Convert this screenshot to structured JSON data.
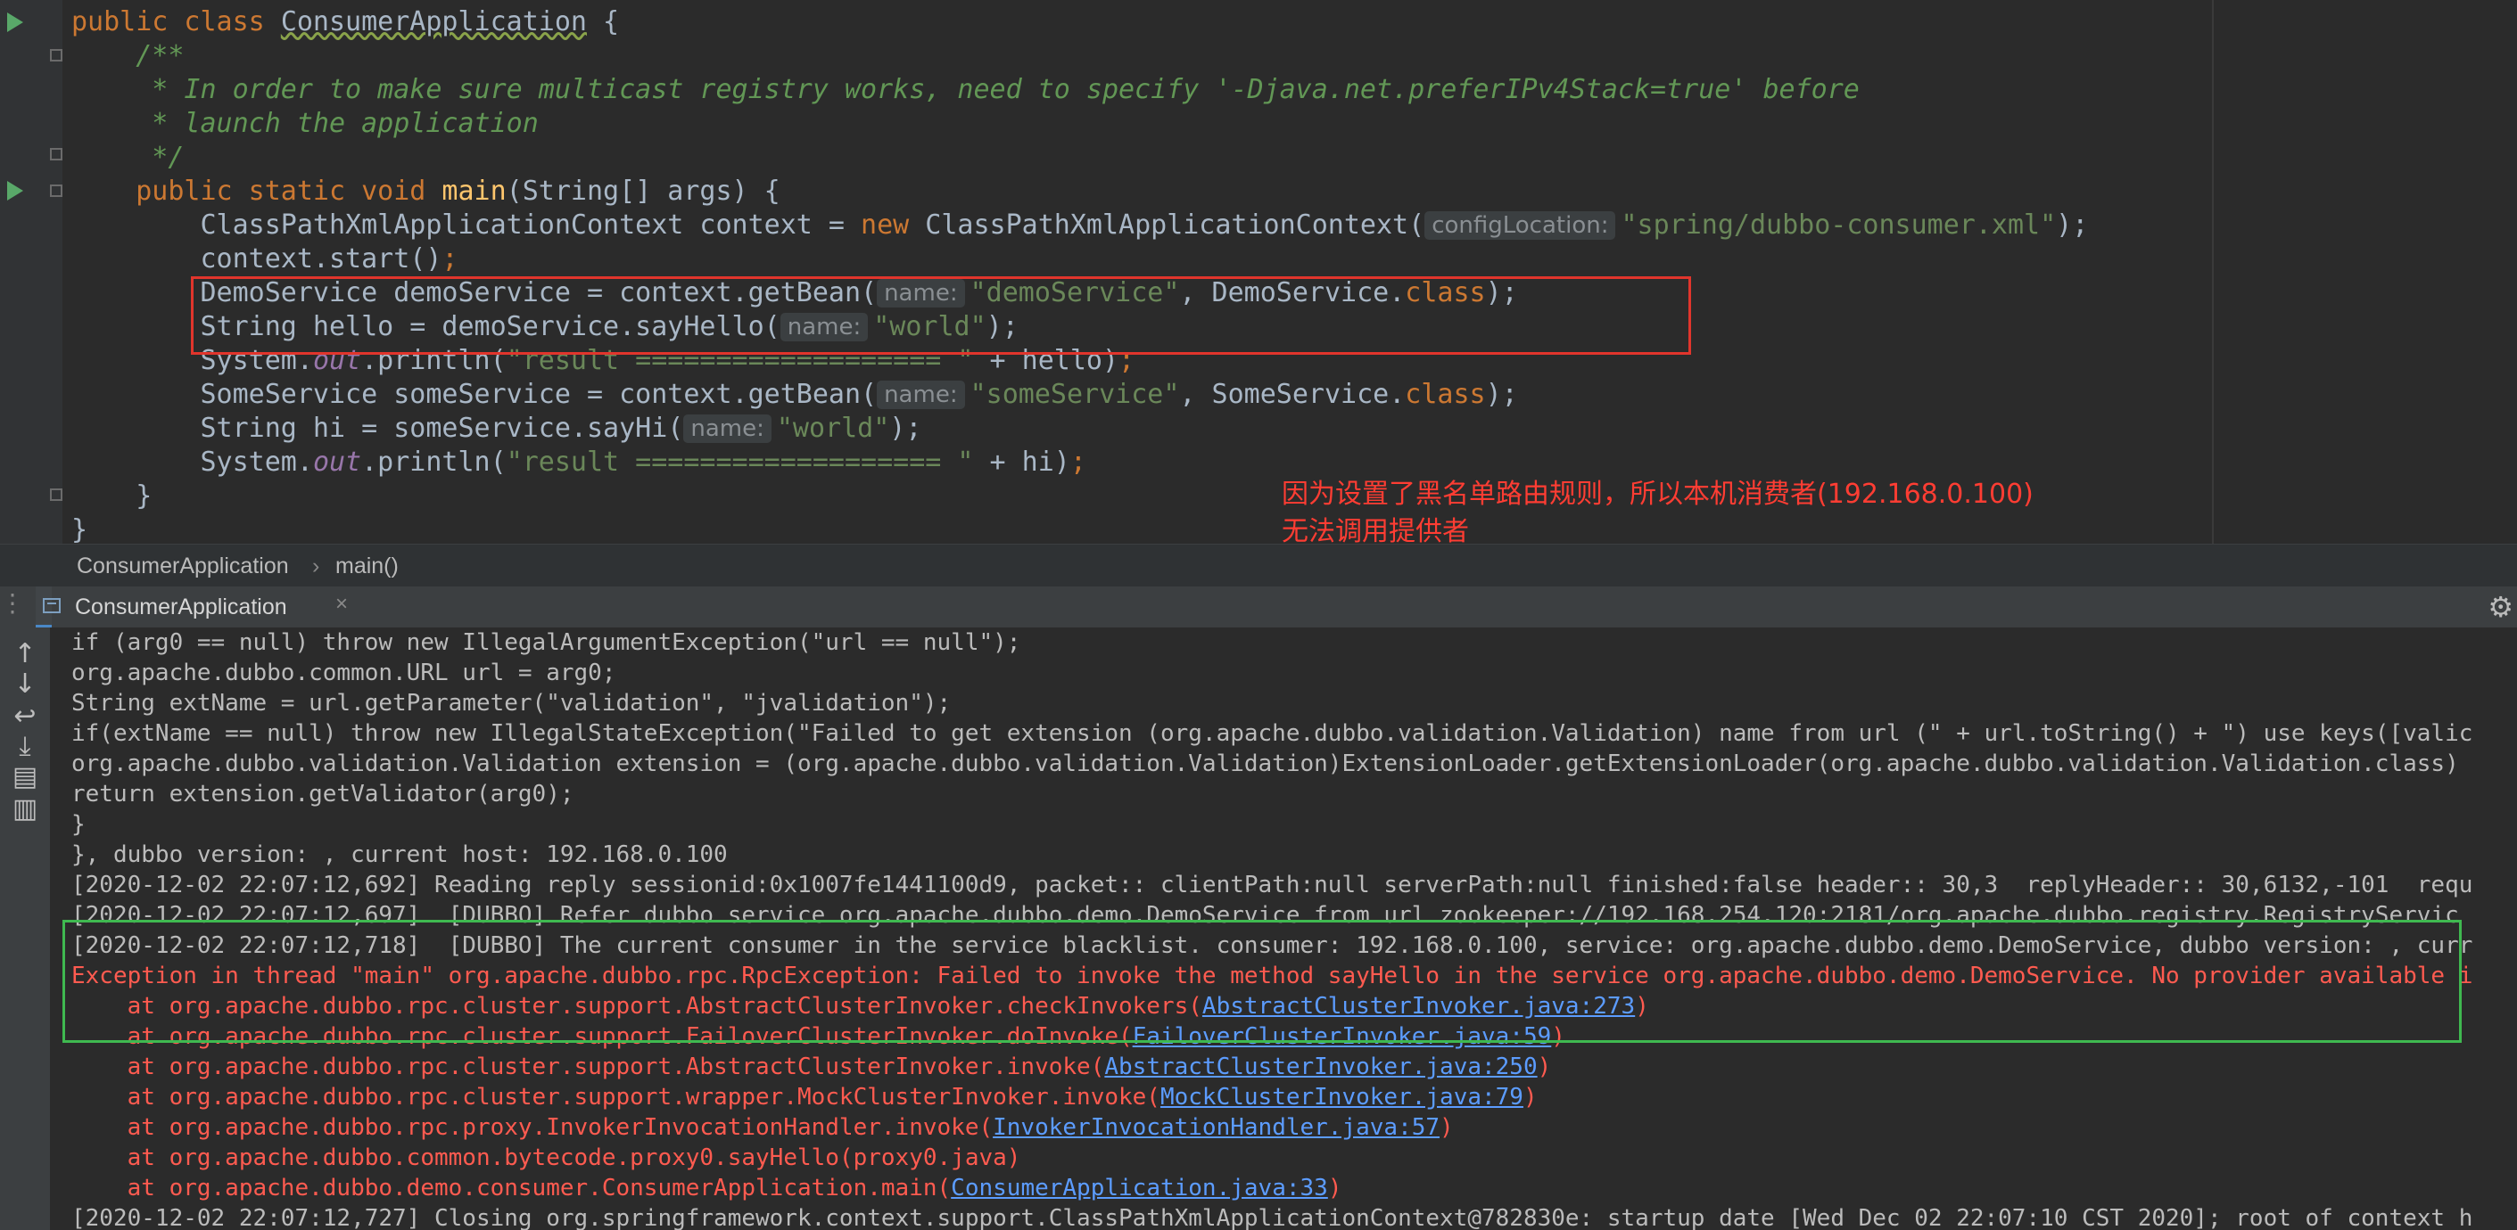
{
  "editor": {
    "lines": {
      "l1_kw": "public class ",
      "l1_class": "ConsumerApplication",
      "l1_rest": " {",
      "l2": "    /**",
      "l3": "     * In order to make sure multicast registry works, need to specify '-Djava.net.preferIPv4Stack=true' before",
      "l4": "     * launch the application",
      "l5": "     */",
      "l6_kw": "    public static void ",
      "l6_fn": "main",
      "l6_rest": "(String[] args) {",
      "l7_a": "        ClassPathXmlApplicationContext context = ",
      "l7_new": "new ",
      "l7_b": "ClassPathXmlApplicationContext(",
      "l7_hint": "configLocation:",
      "l7_str": "\"spring/dubbo-consumer.xml\"",
      "l7_end": ");",
      "l8_a": "        context.start()",
      "l8_end": ";",
      "l9_a": "        DemoService demoService = context.getBean(",
      "l9_hint": "name:",
      "l9_str": "\"demoService\"",
      "l9_b": ", DemoService.",
      "l9_kw": "class",
      "l9_end": ");",
      "l10_a": "        String hello = demoService.sayHello(",
      "l10_hint": "name:",
      "l10_str": "\"world\"",
      "l10_end": ");",
      "l11_a": "        System.",
      "l11_fld": "out",
      "l11_b": ".println(",
      "l11_str": "\"result =================== \"",
      "l11_c": " + hello)",
      "l11_end": ";",
      "l12_a": "        SomeService someService = context.getBean(",
      "l12_hint": "name:",
      "l12_str": "\"someService\"",
      "l12_b": ", SomeService.",
      "l12_kw": "class",
      "l12_end": ");",
      "l13_a": "        String hi = someService.sayHi(",
      "l13_hint": "name:",
      "l13_str": "\"world\"",
      "l13_end": ");",
      "l14_a": "        System.",
      "l14_fld": "out",
      "l14_b": ".println(",
      "l14_str": "\"result =================== \"",
      "l14_c": " + hi)",
      "l14_end": ";",
      "l15": "    }",
      "l16": "}"
    },
    "annotation": "因为设置了黑名单路由规则，所以本机消费者(192.168.0.100)\n无法调用提供者"
  },
  "breadcrumb": {
    "class": "ConsumerApplication",
    "separator": "›",
    "method": "main()"
  },
  "run_panel": {
    "tab_label": "ConsumerApplication",
    "close_glyph": "×",
    "gear_glyph": "⚙",
    "toolbar_icons": [
      "arrow-up-icon",
      "arrow-down-icon",
      "soft-wrap-icon",
      "scroll-to-end-icon",
      "print-icon",
      "trash-icon"
    ]
  },
  "console": {
    "lines": [
      "if (arg0 == null) throw new IllegalArgumentException(\"url == null\");",
      "org.apache.dubbo.common.URL url = arg0;",
      "String extName = url.getParameter(\"validation\", \"jvalidation\");",
      "if(extName == null) throw new IllegalStateException(\"Failed to get extension (org.apache.dubbo.validation.Validation) name from url (\" + url.toString() + \") use keys([valic",
      "org.apache.dubbo.validation.Validation extension = (org.apache.dubbo.validation.Validation)ExtensionLoader.getExtensionLoader(org.apache.dubbo.validation.Validation.class)",
      "return extension.getValidator(arg0);",
      "}",
      "}, dubbo version: , current host: 192.168.0.100",
      "[2020-12-02 22:07:12,692] Reading reply sessionid:0x1007fe1441100d9, packet:: clientPath:null serverPath:null finished:false header:: 30,3  replyHeader:: 30,6132,-101  requ",
      "[2020-12-02 22:07:12,697]  [DUBBO] Refer dubbo service org.apache.dubbo.demo.DemoService from url zookeeper://192.168.254.120:2181/org.apache.dubbo.registry.RegistryServic",
      "[2020-12-02 22:07:12,718]  [DUBBO] The current consumer in the service blacklist. consumer: 192.168.0.100, service: org.apache.dubbo.demo.DemoService, dubbo version: , curr"
    ],
    "exception": "Exception in thread \"main\" org.apache.dubbo.rpc.RpcException: Failed to invoke the method sayHello in the service org.apache.dubbo.demo.DemoService. No provider available i",
    "stack": [
      {
        "text": "    at org.apache.dubbo.rpc.cluster.support.AbstractClusterInvoker.checkInvokers(",
        "link": "AbstractClusterInvoker.java:273",
        "end": ")"
      },
      {
        "text": "    at org.apache.dubbo.rpc.cluster.support.FailoverClusterInvoker.doInvoke(",
        "link": "FailoverClusterInvoker.java:59",
        "end": ")"
      },
      {
        "text": "    at org.apache.dubbo.rpc.cluster.support.AbstractClusterInvoker.invoke(",
        "link": "AbstractClusterInvoker.java:250",
        "end": ")"
      },
      {
        "text": "    at org.apache.dubbo.rpc.cluster.support.wrapper.MockClusterInvoker.invoke(",
        "link": "MockClusterInvoker.java:79",
        "end": ")"
      },
      {
        "text": "    at org.apache.dubbo.rpc.proxy.InvokerInvocationHandler.invoke(",
        "link": "InvokerInvocationHandler.java:57",
        "end": ")"
      },
      {
        "text": "    at org.apache.dubbo.common.bytecode.proxy0.sayHello(proxy0.java)",
        "link": "",
        "end": ""
      },
      {
        "text": "    at org.apache.dubbo.demo.consumer.ConsumerApplication.main(",
        "link": "ConsumerApplication.java:33",
        "end": ")"
      }
    ],
    "last_line": "[2020-12-02 22:07:12,727] Closing org.springframework.context.support.ClassPathXmlApplicationContext@782830e: startup date [Wed Dec 02 22:07:10 CST 2020]; root of context h"
  }
}
